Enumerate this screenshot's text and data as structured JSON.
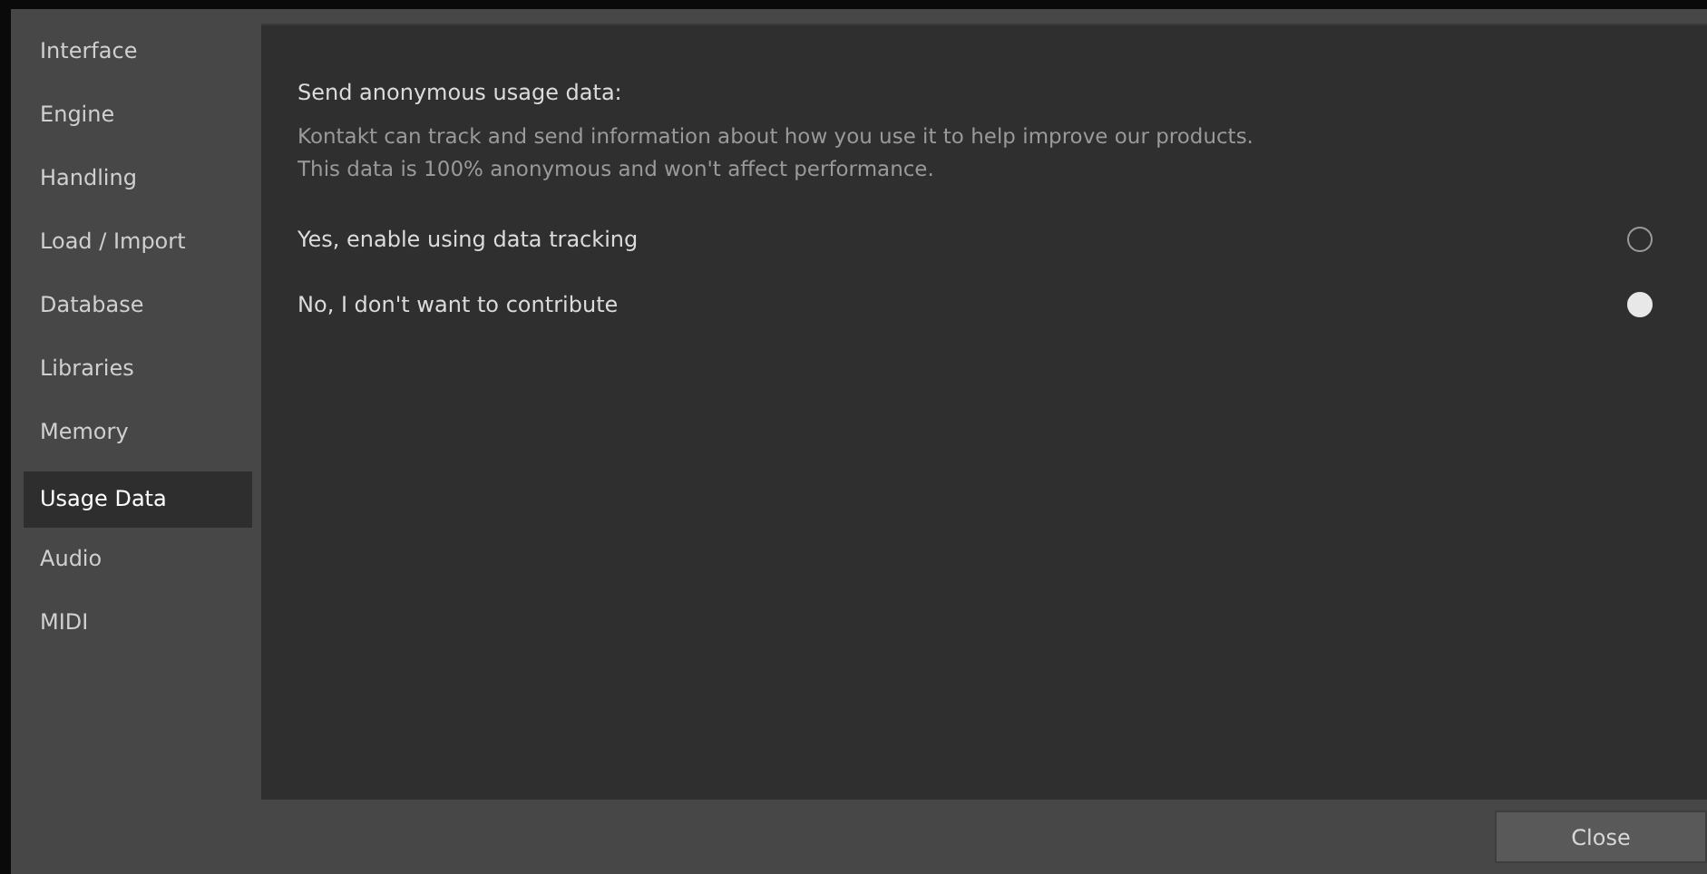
{
  "sidebar": {
    "items": [
      {
        "label": "Interface",
        "selected": false
      },
      {
        "label": "Engine",
        "selected": false
      },
      {
        "label": "Handling",
        "selected": false
      },
      {
        "label": "Load / Import",
        "selected": false
      },
      {
        "label": "Database",
        "selected": false
      },
      {
        "label": "Libraries",
        "selected": false
      },
      {
        "label": "Memory",
        "selected": false
      },
      {
        "label": "Usage Data",
        "selected": true
      },
      {
        "label": "Audio",
        "selected": false
      },
      {
        "label": "MIDI",
        "selected": false
      }
    ]
  },
  "panel": {
    "heading": "Send anonymous usage data:",
    "description": [
      "Kontakt can track and send information about how you use it to help improve our products.",
      "This data is 100% anonymous and won't affect performance."
    ],
    "options": [
      {
        "label": "Yes, enable using data tracking",
        "selected": false
      },
      {
        "label": "No, I don't want to contribute",
        "selected": true
      }
    ]
  },
  "buttons": [
    "Close"
  ]
}
